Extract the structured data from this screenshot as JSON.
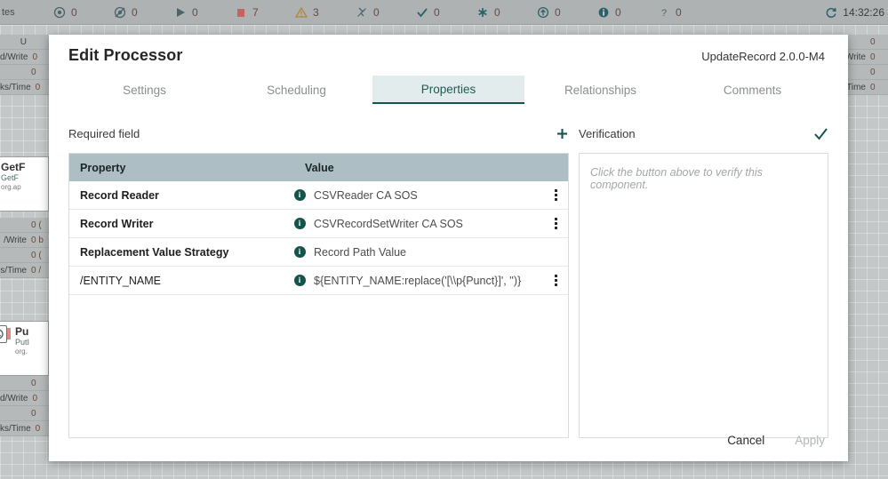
{
  "statusbar": {
    "left_label": "tes",
    "items": [
      {
        "icon": "target-icon",
        "count": "0"
      },
      {
        "icon": "no-transmit-icon",
        "count": "0"
      },
      {
        "icon": "play-icon",
        "count": "0"
      },
      {
        "icon": "stop-square-icon",
        "count": "7"
      },
      {
        "icon": "warning-icon",
        "count": "3"
      },
      {
        "icon": "disconnected-plug-icon",
        "count": "0"
      },
      {
        "icon": "check-icon",
        "count": "0"
      },
      {
        "icon": "asterisk-icon",
        "count": "0"
      },
      {
        "icon": "upload-arrow-icon",
        "count": "0"
      },
      {
        "icon": "info-filled-icon",
        "count": "0"
      },
      {
        "icon": "question-icon",
        "count": "0"
      }
    ],
    "refresh_icon": "refresh-icon",
    "time": "14:32:26"
  },
  "canvas": {
    "left_strips": [
      {
        "rows": [
          {
            "label": "U",
            "value": ""
          },
          {
            "label": "d/Write",
            "value": "0"
          },
          {
            "label": "",
            "value": "0"
          },
          {
            "label": "ks/Time",
            "value": "0"
          }
        ]
      }
    ],
    "processors": [
      {
        "name": "GetF",
        "type": "GetF",
        "package": "org.ap",
        "rows": [
          {
            "label": "",
            "value": "0 ("
          },
          {
            "label": "/Write",
            "value": "0 b"
          },
          {
            "label": "",
            "value": "0 ("
          },
          {
            "label": "s/Time",
            "value": "0 /"
          }
        ]
      },
      {
        "name": "Pu",
        "type": "PutI",
        "package": "org.",
        "rows": [
          {
            "label": "",
            "value": "0"
          },
          {
            "label": "d/Write",
            "value": "0"
          },
          {
            "label": "",
            "value": "0"
          },
          {
            "label": "ks/Time",
            "value": "0"
          }
        ]
      }
    ],
    "right_strip": {
      "rows": [
        {
          "label": "",
          "value": "0"
        },
        {
          "label": "l/Write",
          "value": "0"
        },
        {
          "label": "",
          "value": "0"
        },
        {
          "label": "s/Time",
          "value": "0"
        }
      ]
    }
  },
  "dialog": {
    "title": "Edit Processor",
    "version": "UpdateRecord 2.0.0-M4",
    "tabs": [
      {
        "label": "Settings",
        "active": false
      },
      {
        "label": "Scheduling",
        "active": false
      },
      {
        "label": "Properties",
        "active": true
      },
      {
        "label": "Relationships",
        "active": false
      },
      {
        "label": "Comments",
        "active": false
      }
    ],
    "properties_section": {
      "label": "Required field",
      "add_icon": "plus-icon"
    },
    "verification_section": {
      "label": "Verification",
      "verify_icon": "check-icon",
      "placeholder": "Click the button above to verify this component."
    },
    "table": {
      "columns": [
        "Property",
        "Value"
      ],
      "rows": [
        {
          "property": "Record Reader",
          "required": true,
          "info_icon": "info-icon",
          "value": "CSVReader CA SOS",
          "menu_icon": "kebab-menu-icon",
          "has_menu": true
        },
        {
          "property": "Record Writer",
          "required": true,
          "info_icon": "info-icon",
          "value": "CSVRecordSetWriter CA SOS",
          "menu_icon": "kebab-menu-icon",
          "has_menu": true
        },
        {
          "property": "Replacement Value Strategy",
          "required": true,
          "info_icon": "info-icon",
          "value": "Record Path Value",
          "menu_icon": "",
          "has_menu": false
        },
        {
          "property": "/ENTITY_NAME",
          "required": false,
          "info_icon": "info-icon",
          "value": "${ENTITY_NAME:replace('[\\\\p{Punct}]', '')}",
          "menu_icon": "kebab-menu-icon",
          "has_menu": true
        }
      ]
    },
    "footer": {
      "cancel_label": "Cancel",
      "apply_label": "Apply"
    }
  },
  "colors": {
    "accent": "#16534c",
    "tab_active_bg": "#e3ecec",
    "table_header_bg": "#adbec4",
    "canvas_bg": "#c3c7c7",
    "status_bar_bg": "#aeb2b3",
    "error_red": "#d98b85"
  }
}
